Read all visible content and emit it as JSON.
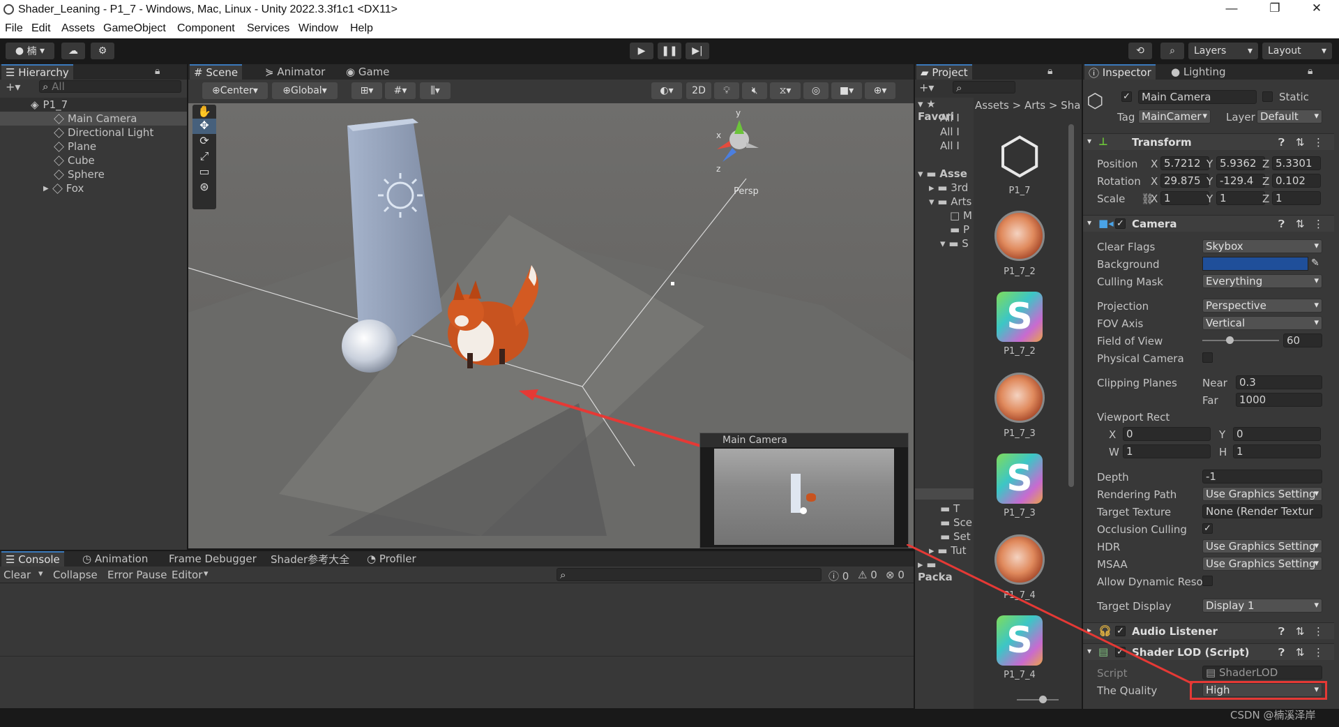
{
  "window": {
    "title": "Shader_Leaning - P1_7 - Windows, Mac, Linux - Unity 2022.3.3f1c1 <DX11>",
    "minimize": "—",
    "restore": "❐",
    "close": "✕"
  },
  "menu": [
    "File",
    "Edit",
    "Assets",
    "GameObject",
    "Component",
    "Services",
    "Window",
    "Help"
  ],
  "toolbar": {
    "account": "楠",
    "layers": "Layers",
    "layout": "Layout"
  },
  "hierarchy": {
    "tab": "Hierarchy",
    "search_placeholder": "All",
    "scene": "P1_7",
    "items": [
      "Main Camera",
      "Directional Light",
      "Plane",
      "Cube",
      "Sphere",
      "Fox"
    ]
  },
  "scene_view": {
    "tabs": [
      "Scene",
      "Animator",
      "Game"
    ],
    "pivot": "Center",
    "space": "Global",
    "mode_2d": "2D",
    "gizmo_label": "Persp",
    "gizmo_axes": {
      "x": "x",
      "y": "y",
      "z": "z"
    },
    "camera_preview_title": "Main Camera"
  },
  "console": {
    "tabs": [
      "Console",
      "Animation",
      "Frame Debugger",
      "Shader参考大全",
      "Profiler"
    ],
    "buttons": [
      "Clear",
      "Collapse",
      "Error Pause",
      "Editor"
    ],
    "counts": {
      "logs": "0",
      "warnings": "0",
      "errors": "0"
    }
  },
  "project": {
    "tab": "Project",
    "breadcrumb": [
      "Assets",
      "Arts",
      "Sha"
    ],
    "tree": [
      "Favori",
      "All I",
      "All I",
      "All I",
      "Asse",
      "3rd",
      "Arts",
      "M",
      "P",
      "S",
      "T",
      "Sce",
      "Set",
      "Tut",
      "Packa"
    ],
    "assets": [
      "P1_7",
      "P1_7_2",
      "P1_7_2",
      "P1_7_3",
      "P1_7_3",
      "P1_7_4",
      "P1_7_4"
    ]
  },
  "inspector": {
    "tabs": [
      "Inspector",
      "Lighting"
    ],
    "object_name": "Main Camera",
    "static_label": "Static",
    "tag_label": "Tag",
    "tag_value": "MainCamer",
    "layer_label": "Layer",
    "layer_value": "Default",
    "transform": {
      "title": "Transform",
      "position_label": "Position",
      "position": [
        "5.7212",
        "5.9362",
        "5.3301"
      ],
      "rotation_label": "Rotation",
      "rotation": [
        "29.875",
        "-129.4",
        "0.102"
      ],
      "scale_label": "Scale",
      "scale": [
        "1",
        "1",
        "1"
      ],
      "axes": [
        "X",
        "Y",
        "Z"
      ]
    },
    "camera": {
      "title": "Camera",
      "clear_flags_label": "Clear Flags",
      "clear_flags": "Skybox",
      "background_label": "Background",
      "background_color": "#1f4f9a",
      "culling_mask_label": "Culling Mask",
      "culling_mask": "Everything",
      "projection_label": "Projection",
      "projection": "Perspective",
      "fov_axis_label": "FOV Axis",
      "fov_axis": "Vertical",
      "fov_label": "Field of View",
      "fov": "60",
      "physical_label": "Physical Camera",
      "clipping_label": "Clipping Planes",
      "near_label": "Near",
      "near": "0.3",
      "far_label": "Far",
      "far": "1000",
      "viewport_label": "Viewport Rect",
      "vx_label": "X",
      "vx": "0",
      "vy_label": "Y",
      "vy": "0",
      "vw_label": "W",
      "vw": "1",
      "vh_label": "H",
      "vh": "1",
      "depth_label": "Depth",
      "depth": "-1",
      "rendering_path_label": "Rendering Path",
      "rendering_path": "Use Graphics Setting",
      "target_texture_label": "Target Texture",
      "target_texture": "None (Render Textur",
      "occlusion_label": "Occlusion Culling",
      "hdr_label": "HDR",
      "hdr": "Use Graphics Setting",
      "msaa_label": "MSAA",
      "msaa": "Use Graphics Setting",
      "dynres_label": "Allow Dynamic Reso",
      "target_display_label": "Target Display",
      "target_display": "Display 1"
    },
    "audio_listener": {
      "title": "Audio Listener"
    },
    "shader_lod": {
      "title": "Shader LOD (Script)",
      "script_label": "Script",
      "script": "ShaderLOD",
      "quality_label": "The Quality",
      "quality": "High"
    }
  },
  "watermark": "CSDN @楠溪泽岸",
  "colors": {
    "accent": "#3a79bb",
    "highlight_box": "#e53935",
    "arrow": "#e53935"
  }
}
